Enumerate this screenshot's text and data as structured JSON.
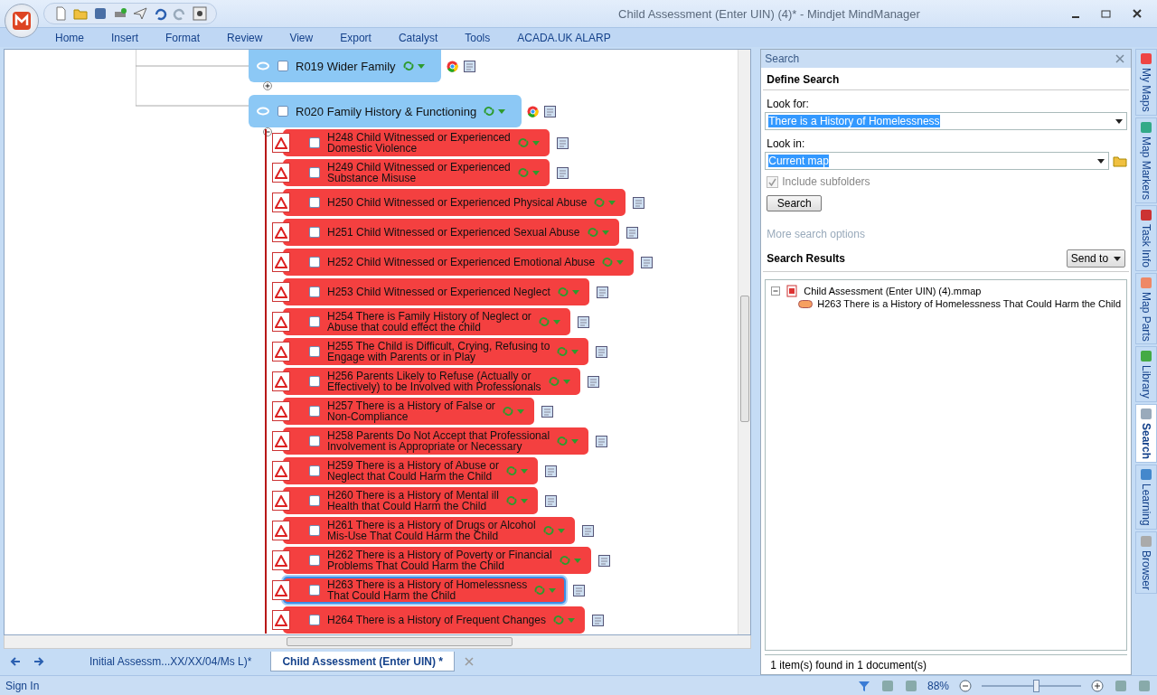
{
  "window": {
    "title": "Child Assessment (Enter UIN)  (4)* - Mindjet MindManager"
  },
  "ribbon_tabs": [
    "Home",
    "Insert",
    "Format",
    "Review",
    "View",
    "Export",
    "Catalyst",
    "Tools",
    "ACADA.UK ALARP"
  ],
  "map": {
    "parent_topics": [
      {
        "label": "R019 Wider Family",
        "expanded": false,
        "checked": false
      },
      {
        "label": "R020 Family History & Functioning",
        "expanded": true,
        "checked": false
      }
    ],
    "topics": [
      {
        "lines": [
          "H248 Child Witnessed or Experienced",
          "Domestic Violence"
        ],
        "selected": false,
        "checked": false
      },
      {
        "lines": [
          "H249 Child Witnessed or Experienced",
          "Substance Misuse"
        ],
        "selected": false,
        "checked": false
      },
      {
        "lines": [
          "H250 Child Witnessed or Experienced Physical Abuse"
        ],
        "selected": false,
        "checked": false
      },
      {
        "lines": [
          "H251 Child Witnessed or Experienced Sexual Abuse"
        ],
        "selected": false,
        "checked": false
      },
      {
        "lines": [
          "H252 Child Witnessed or Experienced Emotional Abuse"
        ],
        "selected": false,
        "checked": false
      },
      {
        "lines": [
          "H253 Child Witnessed or Experienced Neglect"
        ],
        "selected": false,
        "checked": false
      },
      {
        "lines": [
          "H254 There is Family History of Neglect or",
          "Abuse that could effect the child"
        ],
        "selected": false,
        "checked": false
      },
      {
        "lines": [
          "H255 The Child is Difficult, Crying, Refusing to",
          "Engage with Parents or  in Play"
        ],
        "selected": false,
        "checked": false
      },
      {
        "lines": [
          "H256 Parents Likely to Refuse (Actually or",
          "Effectively) to be Involved with Professionals"
        ],
        "selected": false,
        "checked": false
      },
      {
        "lines": [
          "H257 There is a History of False or",
          "Non-Compliance"
        ],
        "selected": false,
        "checked": false
      },
      {
        "lines": [
          "H258 Parents Do Not Accept that Professional",
          "Involvement is Appropriate or Necessary"
        ],
        "selected": false,
        "checked": false
      },
      {
        "lines": [
          "H259 There is a History of Abuse or",
          "Neglect that Could Harm the Child"
        ],
        "selected": false,
        "checked": false
      },
      {
        "lines": [
          "H260 There is a History of Mental ill",
          "Health that Could Harm the Child"
        ],
        "selected": false,
        "checked": false
      },
      {
        "lines": [
          "H261 There is a History of Drugs or Alcohol",
          "Mis-Use That Could Harm the Child"
        ],
        "selected": false,
        "checked": false
      },
      {
        "lines": [
          "H262 There is a History of Poverty or Financial",
          "Problems That Could Harm the Child"
        ],
        "selected": false,
        "checked": false
      },
      {
        "lines": [
          "H263 There is a History of Homelessness",
          "That Could Harm the Child"
        ],
        "selected": true,
        "checked": false
      },
      {
        "lines": [
          "H264 There is a History of Frequent Changes"
        ],
        "selected": false,
        "checked": false
      }
    ]
  },
  "doc_tabs": [
    {
      "label": "Initial Assessm...XX/XX/04/Ms L)*",
      "selected": false
    },
    {
      "label": "Child Assessment (Enter UIN) *",
      "selected": true
    }
  ],
  "search_panel": {
    "title": "Search",
    "section": "Define Search",
    "look_for_label": "Look for:",
    "look_for": "There is a History of Homelessness",
    "look_in_label": "Look in:",
    "look_in": "Current map",
    "include_subfolders": {
      "label": "Include subfolders",
      "checked": true,
      "disabled": true
    },
    "search_button": "Search",
    "more_options": "More search options",
    "results_title": "Search Results",
    "send_to": "Send to",
    "results": [
      {
        "label": "Child Assessment (Enter UIN)  (4).mmap",
        "children": [
          {
            "label": "H263 There is a History of Homelessness That Could Harm the Child"
          }
        ]
      }
    ],
    "status": "1 item(s) found in 1 document(s)"
  },
  "side_tabs": [
    {
      "label": "My Maps",
      "selected": false
    },
    {
      "label": "Map Markers",
      "selected": false
    },
    {
      "label": "Task Info",
      "selected": false
    },
    {
      "label": "Map Parts",
      "selected": false
    },
    {
      "label": "Library",
      "selected": false
    },
    {
      "label": "Search",
      "selected": true
    },
    {
      "label": "Learning",
      "selected": false
    },
    {
      "label": "Browser",
      "selected": false
    }
  ],
  "status_bar": {
    "sign_in": "Sign In",
    "zoom": "88%",
    "zoom_slider": {
      "level": 0.55
    }
  }
}
